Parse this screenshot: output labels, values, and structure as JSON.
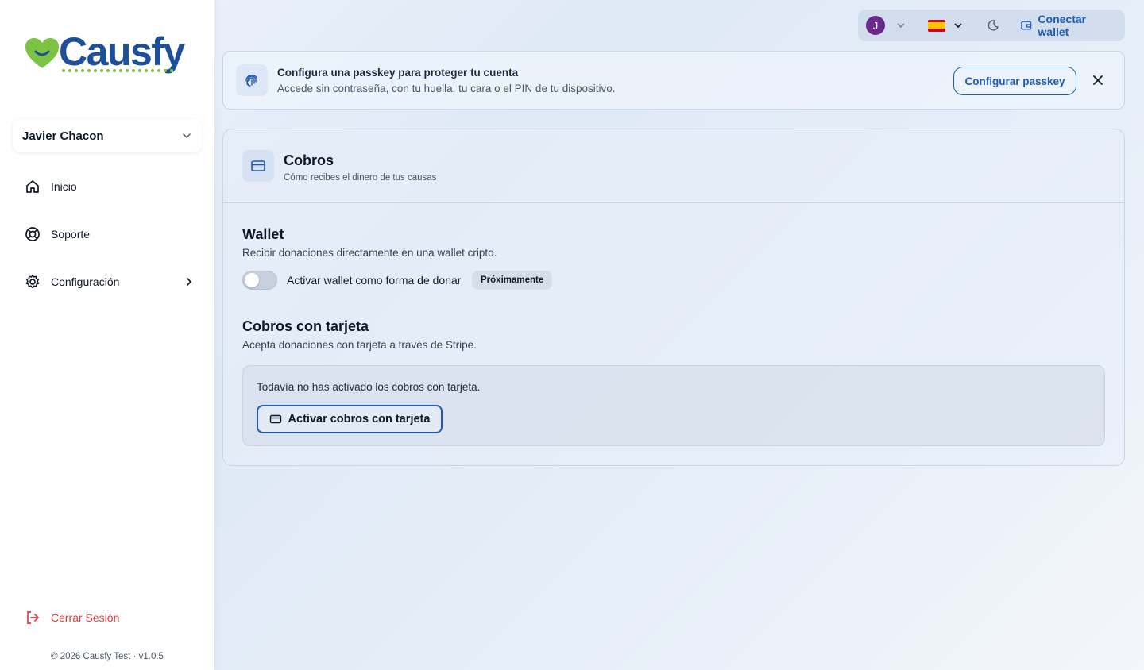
{
  "brand": {
    "name": "Causfy",
    "primary": "#1e4f9a",
    "accent": "#7cc243"
  },
  "sidebar": {
    "user_name": "Javier Chacon",
    "items": [
      {
        "label": "Inicio",
        "icon": "home-icon"
      },
      {
        "label": "Soporte",
        "icon": "lifebuoy-icon"
      },
      {
        "label": "Configuración",
        "icon": "gear-icon"
      }
    ],
    "logout_label": "Cerrar Sesión",
    "footer": "© 2026 Causfy Test · v1.0.5"
  },
  "topbar": {
    "avatar_initial": "J",
    "language": "es",
    "wallet_label": "Conectar wallet"
  },
  "banner": {
    "title": "Configura una passkey para proteger tu cuenta",
    "subtitle": "Accede sin contraseña, con tu huella, tu cara o el PIN de tu dispositivo.",
    "button_label": "Configurar passkey"
  },
  "card": {
    "title": "Cobros",
    "subtitle": "Cómo recibes el dinero de tus causas",
    "wallet": {
      "title": "Wallet",
      "subtitle": "Recibir donaciones directamente en una wallet cripto.",
      "toggle_label": "Activar wallet como forma de donar",
      "toggle_on": false,
      "badge": "Próximamente"
    },
    "stripe": {
      "title": "Cobros con tarjeta",
      "subtitle": "Acepta donaciones con tarjeta a través de Stripe.",
      "note": "Todavía no has activado los cobros con tarjeta.",
      "button_label": "Activar cobros con tarjeta"
    }
  }
}
